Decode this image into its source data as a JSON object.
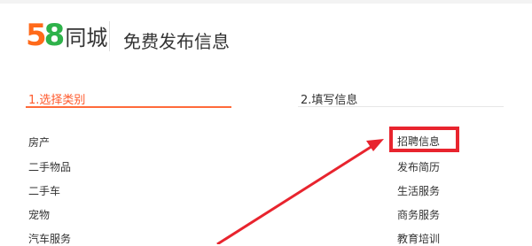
{
  "header": {
    "logo_digit_5": "5",
    "logo_digit_8": "8",
    "logo_text": "同城",
    "title": "免费发布信息"
  },
  "steps": [
    {
      "label": "1.选择类别",
      "active": true
    },
    {
      "label": "2.填写信息",
      "active": false
    }
  ],
  "left_categories": [
    "房产",
    "二手物品",
    "二手车",
    "宠物",
    "汽车服务"
  ],
  "right_categories": [
    "招聘信息",
    "发布简历",
    "生活服务",
    "商务服务",
    "教育培训"
  ],
  "colors": {
    "accent": "#ff5a2c",
    "highlight": "#e8242e",
    "logo_orange": "#ff6a1a",
    "logo_green": "#2eb24a"
  }
}
